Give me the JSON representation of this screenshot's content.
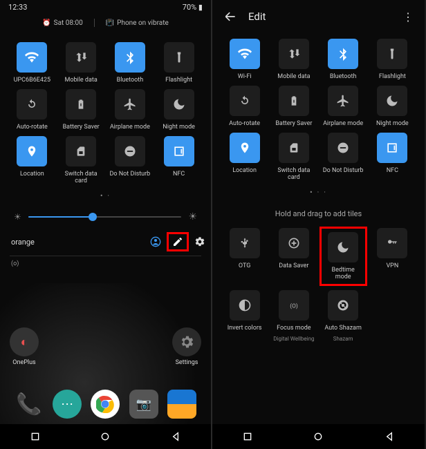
{
  "left": {
    "status": {
      "time": "12:33",
      "battery": "70%"
    },
    "alarm": "Sat 08:00",
    "vibrate": "Phone on vibrate",
    "tiles": [
      {
        "label": "UPC6B6E425",
        "on": true,
        "icon": "wifi"
      },
      {
        "label": "Mobile data",
        "on": false,
        "icon": "data"
      },
      {
        "label": "Bluetooth",
        "on": true,
        "icon": "bt"
      },
      {
        "label": "Flashlight",
        "on": false,
        "icon": "torch"
      },
      {
        "label": "Auto-rotate",
        "on": false,
        "icon": "rotate"
      },
      {
        "label": "Battery Saver",
        "on": false,
        "icon": "batt"
      },
      {
        "label": "Airplane mode",
        "on": false,
        "icon": "plane"
      },
      {
        "label": "Night mode",
        "on": false,
        "icon": "moon"
      },
      {
        "label": "Location",
        "on": true,
        "icon": "pin"
      },
      {
        "label": "Switch data card",
        "on": false,
        "icon": "sim"
      },
      {
        "label": "Do Not Disturb",
        "on": false,
        "icon": "dnd"
      },
      {
        "label": "NFC",
        "on": true,
        "icon": "nfc"
      }
    ],
    "carrier": "orange",
    "notif": "(o)",
    "home_apps": [
      {
        "label": "OnePlus"
      },
      {
        "label": "Settings"
      }
    ]
  },
  "right": {
    "title": "Edit",
    "tiles": [
      {
        "label": "Wi-Fi",
        "on": true,
        "icon": "wifi"
      },
      {
        "label": "Mobile data",
        "on": false,
        "icon": "data"
      },
      {
        "label": "Bluetooth",
        "on": true,
        "icon": "bt"
      },
      {
        "label": "Flashlight",
        "on": false,
        "icon": "torch"
      },
      {
        "label": "Auto-rotate",
        "on": false,
        "icon": "rotate"
      },
      {
        "label": "Battery Saver",
        "on": false,
        "icon": "batt"
      },
      {
        "label": "Airplane mode",
        "on": false,
        "icon": "plane"
      },
      {
        "label": "Night mode",
        "on": false,
        "icon": "moon"
      },
      {
        "label": "Location",
        "on": true,
        "icon": "pin"
      },
      {
        "label": "Switch data card",
        "on": false,
        "icon": "sim"
      },
      {
        "label": "Do Not Disturb",
        "on": false,
        "icon": "dnd"
      },
      {
        "label": "NFC",
        "on": true,
        "icon": "nfc"
      }
    ],
    "instruction": "Hold and drag to add tiles",
    "extra_tiles": [
      {
        "label": "OTG",
        "sub": "",
        "icon": "usb",
        "hl": false
      },
      {
        "label": "Data Saver",
        "sub": "",
        "icon": "dsave",
        "hl": false
      },
      {
        "label": "Bedtime mode",
        "sub": "",
        "icon": "bed",
        "hl": true
      },
      {
        "label": "VPN",
        "sub": "",
        "icon": "key",
        "hl": false
      },
      {
        "label": "Invert colors",
        "sub": "",
        "icon": "inv",
        "hl": false
      },
      {
        "label": "Focus mode",
        "sub": "Digital Wellbeing",
        "icon": "focus",
        "hl": false
      },
      {
        "label": "Auto Shazam",
        "sub": "Shazam",
        "icon": "shazam",
        "hl": false
      }
    ]
  }
}
